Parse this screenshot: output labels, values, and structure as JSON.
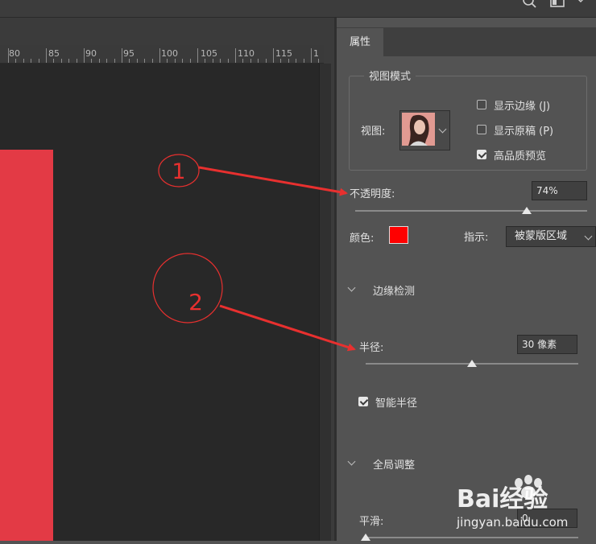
{
  "ruler": {
    "labels": [
      "80",
      "85",
      "90",
      "95",
      "100",
      "105",
      "110",
      "115",
      "1"
    ]
  },
  "panel": {
    "tab_label": "属性",
    "view_mode": {
      "title": "视图模式",
      "view_label": "视图:",
      "options": [
        {
          "label": "显示边缘 (J)",
          "checked": false
        },
        {
          "label": "显示原稿 (P)",
          "checked": false
        },
        {
          "label": "高品质预览",
          "checked": true
        }
      ]
    },
    "opacity": {
      "label": "不透明度:",
      "value": "74%",
      "slider_percent": 74
    },
    "color": {
      "label": "颜色:",
      "swatch": "#ff0000"
    },
    "indicate": {
      "label": "指示:",
      "value": "被蒙版区域"
    },
    "edge_detection": {
      "title": "边缘检测",
      "radius_label": "半径:",
      "radius_value": "30 像素",
      "radius_slider_percent": 50,
      "smart_radius_label": "智能半径",
      "smart_radius_checked": true
    },
    "global_refine": {
      "title": "全局调整",
      "smooth_label": "平滑:",
      "smooth_value": "0",
      "smooth_slider_percent": 0
    }
  },
  "annotations": [
    {
      "number": "1"
    },
    {
      "number": "2"
    }
  ],
  "watermark": {
    "brand": "Bai经验",
    "url": "jingyan.baidu.com"
  },
  "colors": {
    "canvas_shape": "#e33a45",
    "annotation": "#e8302f"
  }
}
